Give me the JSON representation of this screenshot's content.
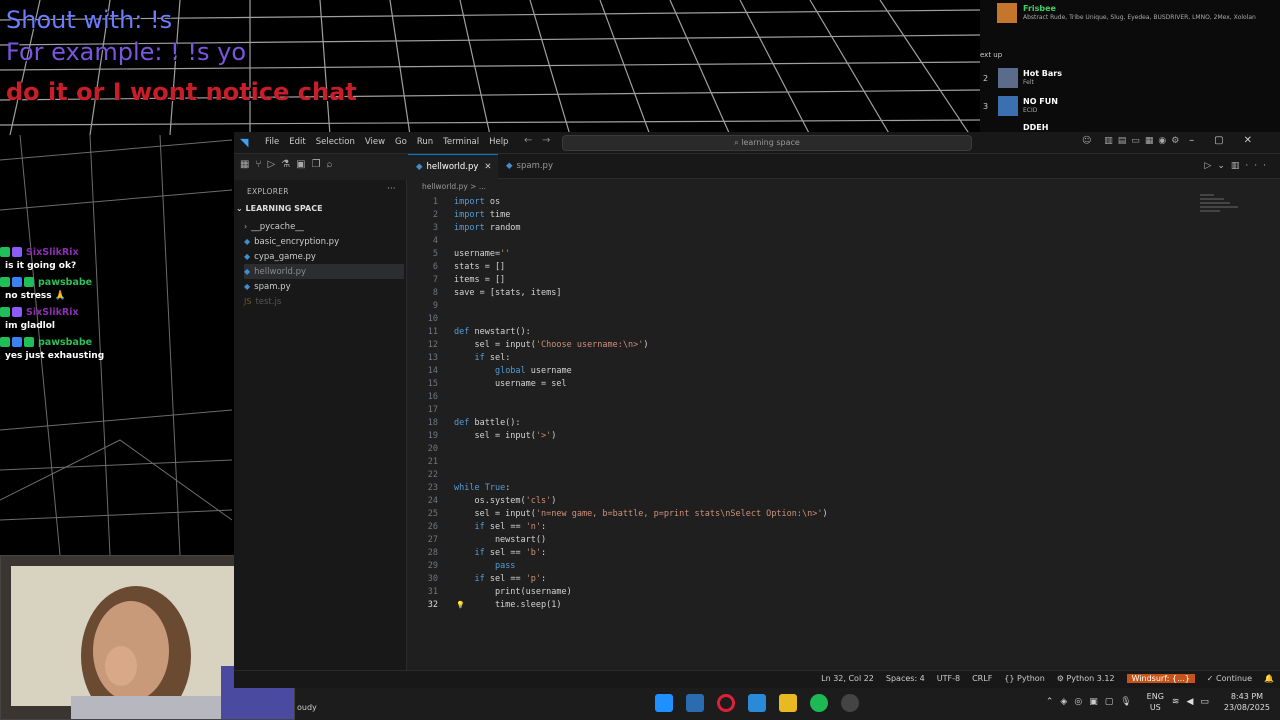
{
  "overlay": {
    "line1": "Shout with: !s",
    "line2": "For example: ! !s yo",
    "line3": "do it or I wont notice chat"
  },
  "queue": {
    "now_playing": {
      "title": "Frisbee",
      "artists": "Abstract Rude, Tribe Unique, Slug, Eyedea, BUSDRIVER, LMNO, 2Mex, Xololan"
    },
    "up_next_label": "ext up",
    "items": [
      {
        "num": "2",
        "title": "Hot Bars",
        "sub": "Felt"
      },
      {
        "num": "3",
        "title": "NO FUN",
        "sub": "ECID"
      },
      {
        "num": "",
        "title": "DDEH",
        "sub": ""
      }
    ]
  },
  "chat": [
    {
      "user": "SixSlikRix",
      "color": "#8b2fb0",
      "text": "is it going ok?"
    },
    {
      "user": "pawsbabe",
      "color": "#2fbf5a",
      "text": "no stress 🙏"
    },
    {
      "user": "SixSlikRix",
      "color": "#8b2fb0",
      "text": "im gladlol"
    },
    {
      "user": "pawsbabe",
      "color": "#2fbf5a",
      "text": "yes just exhausting"
    }
  ],
  "vscode": {
    "menu": [
      "File",
      "Edit",
      "Selection",
      "View",
      "Go",
      "Run",
      "Terminal",
      "Help"
    ],
    "search": "learning space",
    "explorer": {
      "title": "EXPLORER",
      "folder": "LEARNING SPACE",
      "files": [
        {
          "name": "__pycache__",
          "icon": "›"
        },
        {
          "name": "basic_encryption.py",
          "icon": "◆"
        },
        {
          "name": "cypa_game.py",
          "icon": "◆"
        },
        {
          "name": "hellworld.py",
          "icon": "◆"
        },
        {
          "name": "spam.py",
          "icon": "◆"
        },
        {
          "name": "test.js",
          "icon": "JS"
        }
      ]
    },
    "tabs": [
      {
        "name": "hellworld.py"
      },
      {
        "name": "spam.py"
      }
    ],
    "breadcrumb": "hellworld.py > ...",
    "code": [
      "import os",
      "import time",
      "import random",
      "",
      "username=''",
      "stats = []",
      "items = []",
      "save = [stats, items]",
      "",
      "",
      "def newstart():",
      "    sel = input('Choose username:\\n>')",
      "    if sel:",
      "        global username",
      "        username = sel",
      "",
      "",
      "def battle():",
      "    sel = input('>')",
      "",
      "",
      "",
      "while True:",
      "    os.system('cls')",
      "    sel = input('n=new game, b=battle, p=print stats\\nSelect Option:\\n>')",
      "    if sel == 'n':",
      "        newstart()",
      "    if sel == 'b':",
      "        pass",
      "    if sel == 'p':",
      "        print(username)",
      "        time.sleep(1)"
    ],
    "current_line": 32,
    "status": {
      "position": "Ln 32, Col 22",
      "spaces": "Spaces: 4",
      "encoding": "UTF-8",
      "eol": "CRLF",
      "language": "Python",
      "interpreter": "Python 3.12",
      "windsurf": "Windsurf: {...}",
      "continue": "Continue"
    }
  },
  "taskbar": {
    "weather": "oudy",
    "lang": "ENG",
    "region": "US",
    "time": "8:43 PM",
    "date": "23/08/2025"
  }
}
